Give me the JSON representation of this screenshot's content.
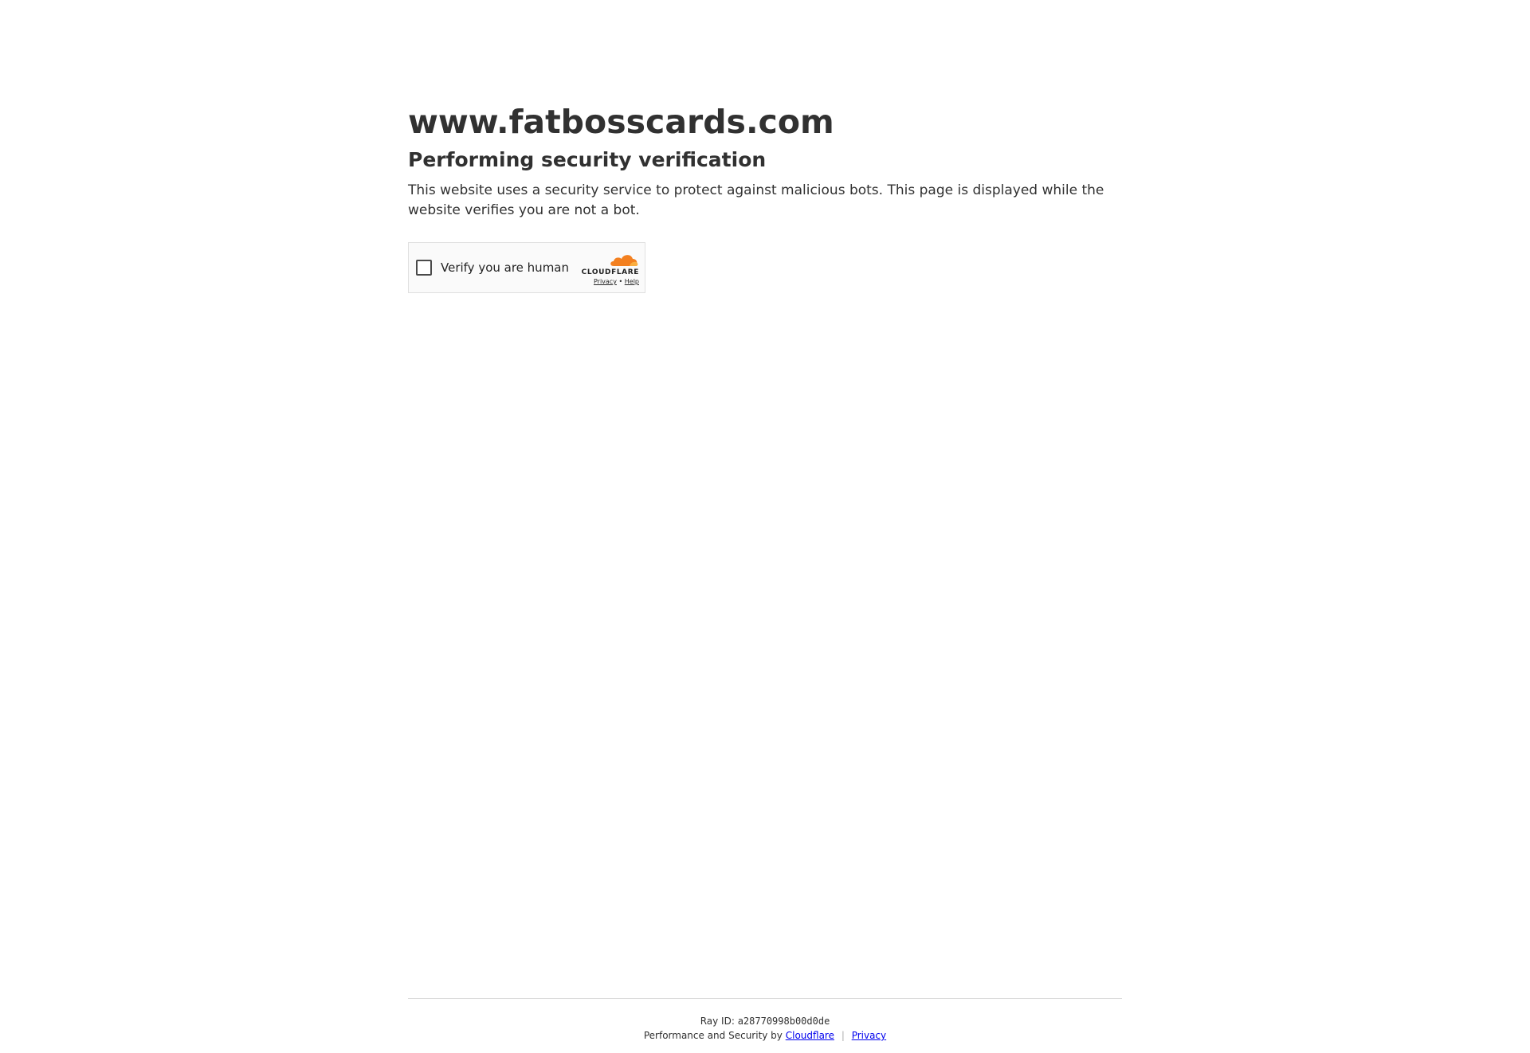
{
  "header": {
    "site_title": "www.fatbosscards.com",
    "headline": "Performing security verification",
    "description": "This website uses a security service to protect against malicious bots. This page is displayed while the website verifies you are not a bot."
  },
  "challenge": {
    "checkbox_label": "Verify you are human",
    "brand_name": "CLOUDFLARE",
    "privacy_link": "Privacy",
    "link_separator": "•",
    "help_link": "Help",
    "checked": false
  },
  "footer": {
    "ray_label": "Ray ID:",
    "ray_id": "a28770998b00d0de",
    "performance_text": "Performance and Security by",
    "cloudflare_link": "Cloudflare",
    "separator": "|",
    "privacy_link": "Privacy"
  },
  "colors": {
    "text": "#313131",
    "link": "#0000ee",
    "cloudflare_orange": "#f38020",
    "cloudflare_light_orange": "#faae40"
  }
}
